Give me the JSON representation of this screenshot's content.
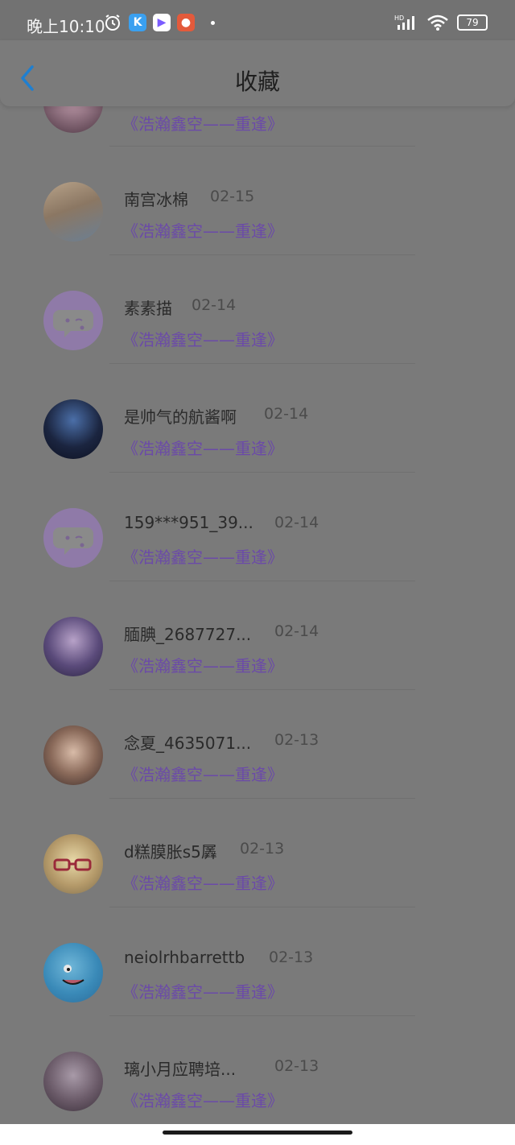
{
  "status": {
    "time": "晚上10:10",
    "battery": "79",
    "hd": "HD"
  },
  "header": {
    "title": "收藏"
  },
  "items": [
    {
      "name": "",
      "date": "",
      "work": "《浩瀚鑫空——重逢》"
    },
    {
      "name": "南宫冰棉",
      "date": "02-15",
      "work": "《浩瀚鑫空——重逢》"
    },
    {
      "name": "素素描",
      "date": "02-14",
      "work": "《浩瀚鑫空——重逢》"
    },
    {
      "name": "是帅气的航酱啊",
      "date": "02-14",
      "work": "《浩瀚鑫空——重逢》"
    },
    {
      "name": "159***951_39...",
      "date": "02-14",
      "work": "《浩瀚鑫空——重逢》"
    },
    {
      "name": "腼腆_2687727...",
      "date": "02-14",
      "work": "《浩瀚鑫空——重逢》"
    },
    {
      "name": "念夏_4635071...",
      "date": "02-13",
      "work": "《浩瀚鑫空——重逢》"
    },
    {
      "name": "d糕膜胀s5羼",
      "date": "02-13",
      "work": "《浩瀚鑫空——重逢》"
    },
    {
      "name": "neiolrhbarrettb",
      "date": "02-13",
      "work": "《浩瀚鑫空——重逢》"
    },
    {
      "name": "璃小月应聘培...",
      "date": "02-13",
      "work": "《浩瀚鑫空——重逢》"
    }
  ]
}
